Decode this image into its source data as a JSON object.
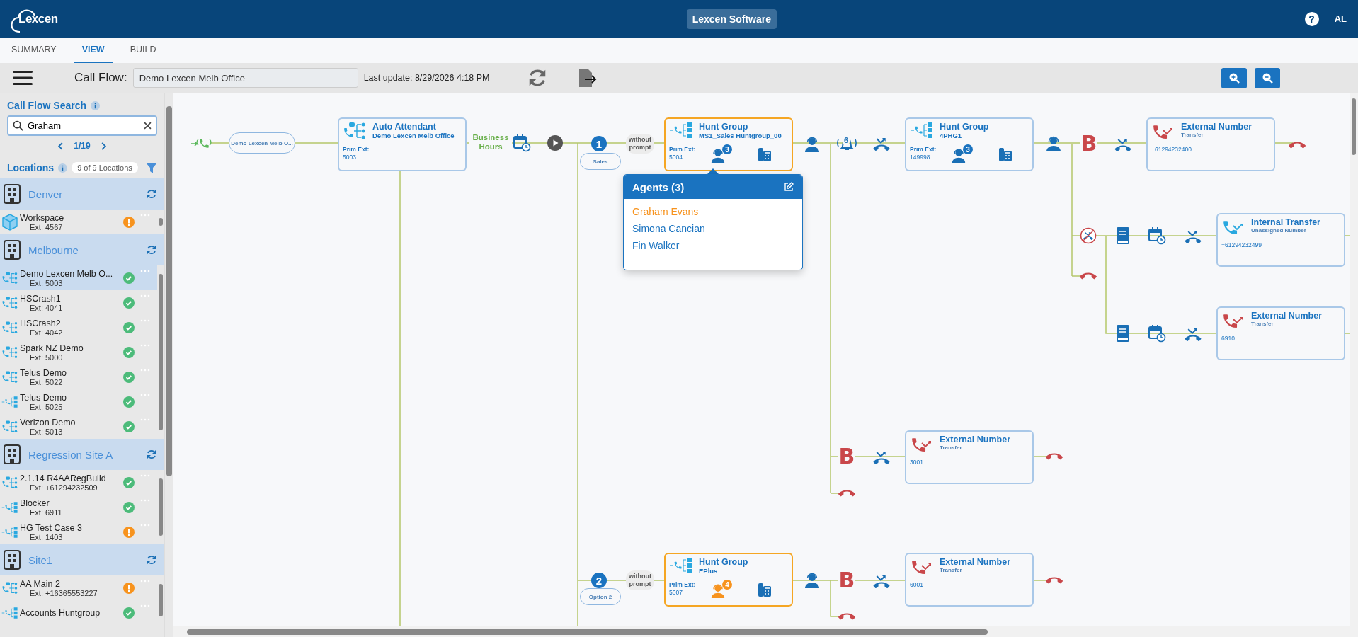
{
  "header": {
    "logo": "Lexcen",
    "title": "Lexcen Software",
    "help": "?",
    "user": "AL"
  },
  "tabs": [
    {
      "label": "SUMMARY",
      "selected": false
    },
    {
      "label": "VIEW",
      "selected": true
    },
    {
      "label": "BUILD",
      "selected": false
    }
  ],
  "toolbar": {
    "label": "Call Flow:",
    "value": "Demo Lexcen Melb Office",
    "last_update": "Last update: 8/29/2026 4:18 PM"
  },
  "sidebar": {
    "search_title": "Call Flow Search",
    "search_value": "Graham",
    "pager": "1/19",
    "locations_title": "Locations",
    "locations_count": "9 of 9 Locations",
    "locations": [
      {
        "name": "Denver",
        "items": [
          {
            "kind": "workspace",
            "name": "Workspace",
            "ext": "Ext: 4567",
            "warning": true,
            "selected": false
          }
        ]
      },
      {
        "name": "Melbourne",
        "items": [
          {
            "kind": "auto_attendant",
            "name": "Demo Lexcen Melb O...",
            "ext": "Ext: 5003",
            "warning": false,
            "selected": true
          },
          {
            "kind": "auto_attendant",
            "name": "HSCrash1",
            "ext": "Ext: 4041",
            "warning": false,
            "selected": false
          },
          {
            "kind": "auto_attendant",
            "name": "HSCrash2",
            "ext": "Ext: 4042",
            "warning": false,
            "selected": false
          },
          {
            "kind": "auto_attendant",
            "name": "Spark NZ Demo",
            "ext": "Ext: 5000",
            "warning": false,
            "selected": false
          },
          {
            "kind": "auto_attendant",
            "name": "Telus Demo",
            "ext": "Ext: 5022",
            "warning": false,
            "selected": false
          },
          {
            "kind": "hunt_group",
            "name": "Telus Demo",
            "ext": "Ext: 5025",
            "warning": false,
            "selected": false
          },
          {
            "kind": "auto_attendant",
            "name": "Verizon Demo",
            "ext": "Ext: 5013",
            "warning": false,
            "selected": false
          }
        ]
      },
      {
        "name": "Regression Site A",
        "items": [
          {
            "kind": "auto_attendant",
            "name": "2.1.14 R4AARegBuild",
            "ext": "Ext: +61294232509",
            "warning": false,
            "selected": false
          },
          {
            "kind": "hunt_group",
            "name": "Blocker",
            "ext": "Ext: 6911",
            "warning": false,
            "selected": false
          },
          {
            "kind": "hunt_group",
            "name": "HG Test Case 3",
            "ext": "Ext: 1403",
            "warning": true,
            "selected": false
          }
        ]
      },
      {
        "name": "Site1",
        "items": [
          {
            "kind": "auto_attendant",
            "name": "AA Main 2",
            "ext": "Ext: +16365553227",
            "warning": true,
            "selected": false
          },
          {
            "kind": "hunt_group",
            "name": "Accounts Huntgroup",
            "warning": false,
            "selected": false
          }
        ]
      }
    ]
  },
  "canvas": {
    "entry_label": "Demo Lexcen Melb O...",
    "schedule_label": "Business Hours",
    "options": [
      {
        "number": "1",
        "name": "Sales",
        "prompt": "without prompt"
      },
      {
        "number": "2",
        "name": "Option 2",
        "prompt": "without prompt"
      }
    ],
    "ring_count": "6",
    "busy_marks": [
      "B",
      "B",
      "B"
    ],
    "cards": [
      {
        "kind": "auto_attendant",
        "title": "Auto Attendant",
        "subtitle": "Demo Lexcen Melb Office",
        "ext_label": "Prim Ext:",
        "ext": "5003",
        "highlighted": false
      },
      {
        "kind": "hunt_group",
        "title": "Hunt Group",
        "subtitle": "MS1_Sales Huntgroup_00",
        "ext_label": "Prim Ext:",
        "ext": "5004",
        "agents": "3",
        "agents_highlighted": false,
        "highlighted": true
      },
      {
        "kind": "hunt_group",
        "title": "Hunt Group",
        "subtitle": "4PHG1",
        "ext_label": "Prim Ext:",
        "ext": "149998",
        "agents": "3",
        "agents_highlighted": false,
        "highlighted": false
      },
      {
        "kind": "external_number",
        "title": "External Number",
        "subtitle": "Transfer",
        "ext": "+61294232400",
        "highlighted": false
      },
      {
        "kind": "internal_transfer",
        "title": "Internal Transfer",
        "subtitle": "Unassigned Number",
        "ext": "+61294232499",
        "highlighted": false
      },
      {
        "kind": "external_number",
        "title": "External Number",
        "subtitle": "Transfer",
        "ext": "6910",
        "highlighted": false
      },
      {
        "kind": "external_number",
        "title": "External Number",
        "subtitle": "Transfer",
        "ext": "3001",
        "highlighted": false
      },
      {
        "kind": "hunt_group",
        "title": "Hunt Group",
        "subtitle": "EPlus",
        "ext_label": "Prim Ext:",
        "ext": "5007",
        "agents": "4",
        "agents_highlighted": true,
        "highlighted": true
      },
      {
        "kind": "external_number",
        "title": "External Number",
        "subtitle": "Transfer",
        "ext": "6001",
        "highlighted": false
      }
    ],
    "agents_popup": {
      "title": "Agents (3)",
      "agents": [
        {
          "name": "Graham Evans",
          "match": true
        },
        {
          "name": "Simona Cancian",
          "match": false
        },
        {
          "name": "Fin Walker",
          "match": false
        }
      ]
    }
  }
}
